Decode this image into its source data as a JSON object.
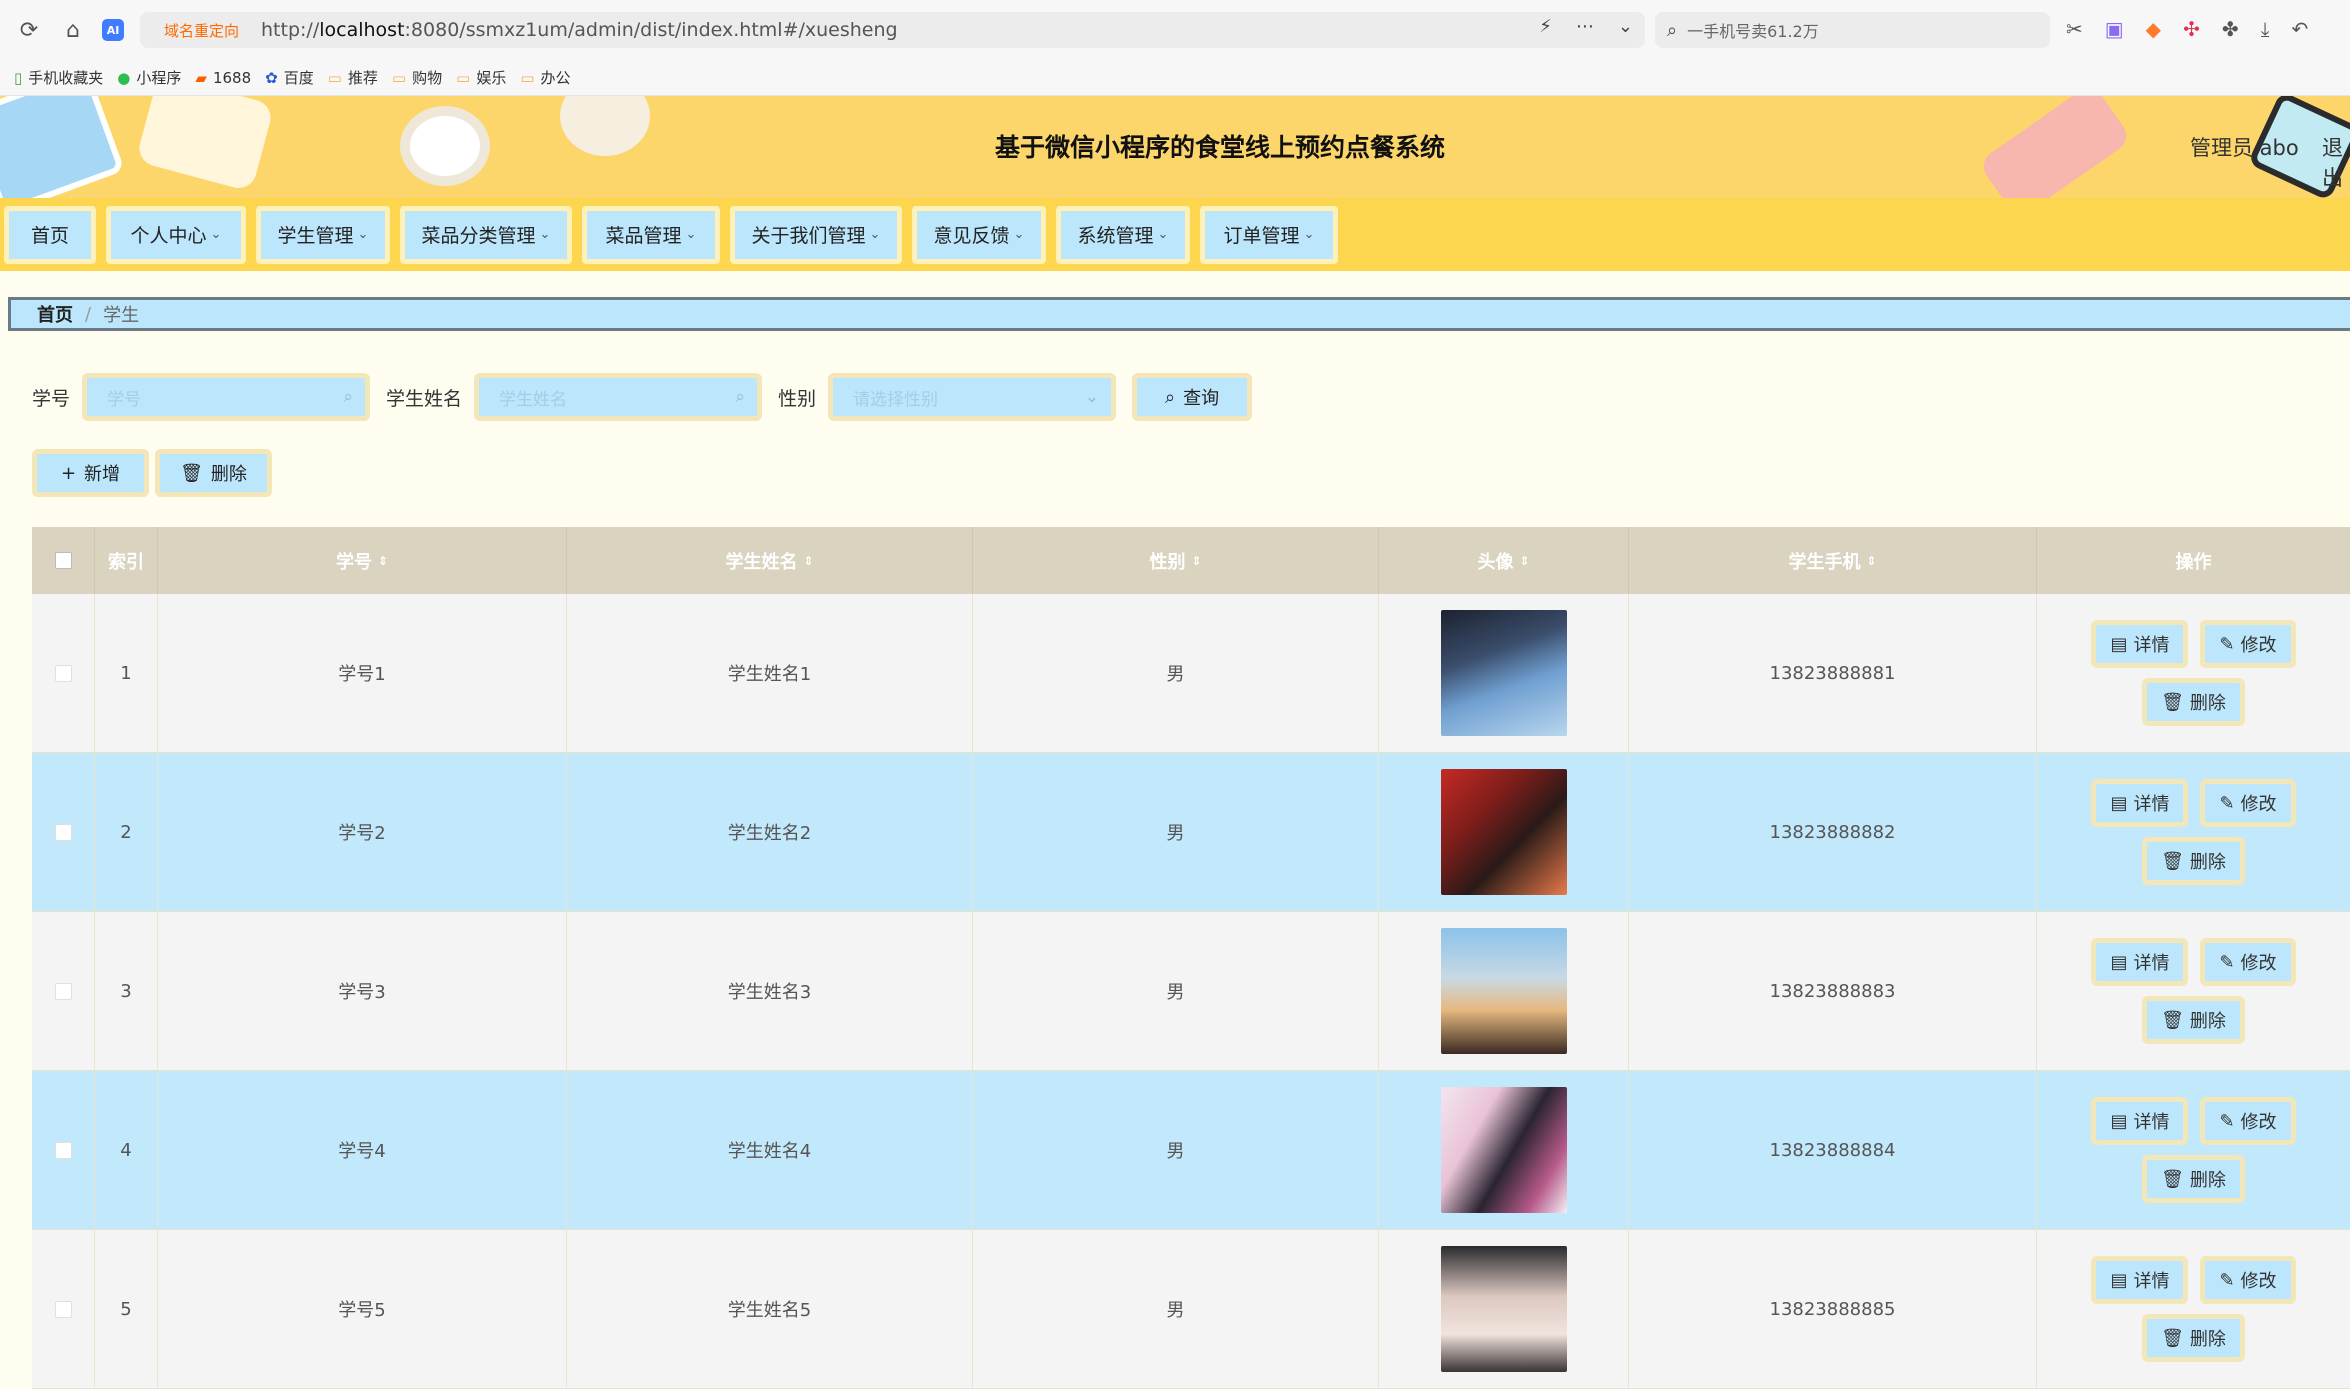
{
  "browser": {
    "redirect_label": "域名重定向",
    "url_prefix": "http://",
    "url_host": "localhost",
    "url_rest": ":8080/ssmxz1um/admin/dist/index.html#/xuesheng",
    "search_text": "一手机号卖61.2万",
    "bookmarks": [
      "手机收藏夹",
      "小程序",
      "1688",
      "百度",
      "推荐",
      "购物",
      "娱乐",
      "办公"
    ]
  },
  "header": {
    "title": "基于微信小程序的食堂线上预约点餐系统",
    "user": "管理员 abo",
    "logout": "退出"
  },
  "nav": {
    "items": [
      {
        "label": "首页",
        "has_menu": false
      },
      {
        "label": "个人中心",
        "has_menu": true
      },
      {
        "label": "学生管理",
        "has_menu": true
      },
      {
        "label": "菜品分类管理",
        "has_menu": true
      },
      {
        "label": "菜品管理",
        "has_menu": true
      },
      {
        "label": "关于我们管理",
        "has_menu": true
      },
      {
        "label": "意见反馈",
        "has_menu": true
      },
      {
        "label": "系统管理",
        "has_menu": true
      },
      {
        "label": "订单管理",
        "has_menu": true
      }
    ]
  },
  "breadcrumb": {
    "home": "首页",
    "sep": "/",
    "current": "学生"
  },
  "search": {
    "xuehao_label": "学号",
    "xuehao_placeholder": "学号",
    "name_label": "学生姓名",
    "name_placeholder": "学生姓名",
    "gender_label": "性别",
    "gender_placeholder": "请选择性别",
    "query_button": "查询"
  },
  "actions": {
    "add": "新增",
    "delete": "删除"
  },
  "table": {
    "headers": [
      "索引",
      "学号",
      "学生姓名",
      "性别",
      "头像",
      "学生手机",
      "操作"
    ],
    "op_detail": "详情",
    "op_edit": "修改",
    "op_delete": "删除",
    "rows": [
      {
        "index": "1",
        "xuehao": "学号1",
        "name": "学生姓名1",
        "gender": "男",
        "phone": "13823888881"
      },
      {
        "index": "2",
        "xuehao": "学号2",
        "name": "学生姓名2",
        "gender": "男",
        "phone": "13823888882"
      },
      {
        "index": "3",
        "xuehao": "学号3",
        "name": "学生姓名3",
        "gender": "男",
        "phone": "13823888883"
      },
      {
        "index": "4",
        "xuehao": "学号4",
        "name": "学生姓名4",
        "gender": "男",
        "phone": "13823888884"
      },
      {
        "index": "5",
        "xuehao": "学号5",
        "name": "学生姓名5",
        "gender": "男",
        "phone": "13823888885"
      }
    ]
  },
  "colors": {
    "header_bg": "#fcd66a",
    "nav_bg": "#fcd64f",
    "button_bg": "#bce6fb",
    "button_border": "#f3e6b9",
    "table_head": "#d9d3c0",
    "row_alt": "#c1e8fb"
  }
}
